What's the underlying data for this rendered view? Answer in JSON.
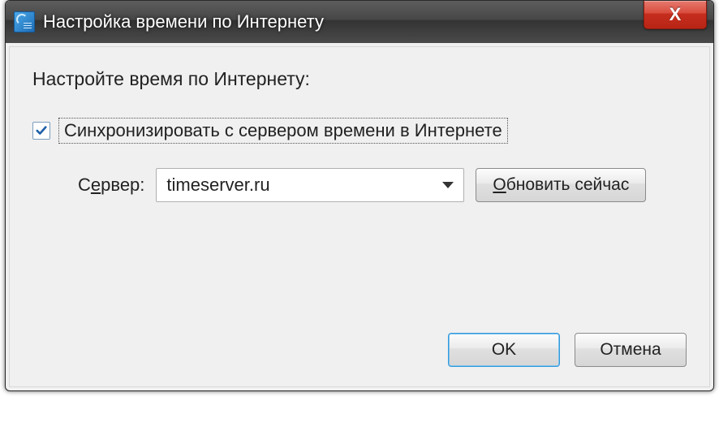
{
  "window": {
    "title": "Настройка времени по Интернету",
    "close_glyph": "X"
  },
  "content": {
    "heading": "Настройте время по Интернету:",
    "sync_checkbox": {
      "checked": true,
      "label": "Синхронизировать с сервером времени в Интернете"
    },
    "server": {
      "label_pre": "С",
      "label_u": "е",
      "label_post": "рвер:",
      "value": "timeserver.ru"
    },
    "update_button": {
      "pre": "",
      "u": "О",
      "post": "бновить сейчас"
    }
  },
  "actions": {
    "ok": "OK",
    "cancel": "Отмена"
  }
}
